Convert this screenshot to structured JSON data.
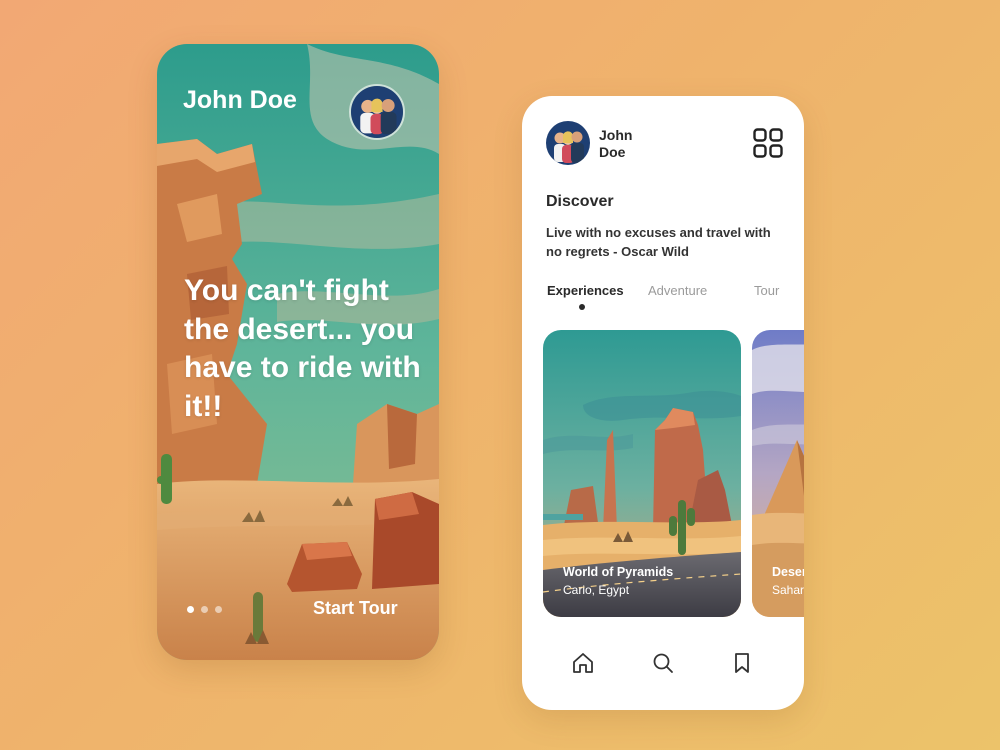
{
  "onboarding": {
    "user_name": "John Doe",
    "headline": "You can't fight the desert... you have to ride with it!!",
    "pager": {
      "count": 3,
      "active": 0
    },
    "start_label": "Start Tour"
  },
  "discover": {
    "user_name": "John Doe",
    "title": "Discover",
    "quote": "Live with no excuses and travel with no regrets - Oscar Wild",
    "tabs": [
      {
        "label": "Experiences",
        "active": true
      },
      {
        "label": "Adventure",
        "active": false
      },
      {
        "label": "Tour",
        "active": false
      }
    ],
    "cards": [
      {
        "title": "World of Pyramids",
        "subtitle": "Cario, Egypt"
      },
      {
        "title": "Deser",
        "subtitle": "Sahar"
      }
    ],
    "bottom_nav": [
      "home-icon",
      "search-icon",
      "bookmark-icon"
    ]
  },
  "icons": {
    "grid": "grid-icon",
    "avatar": "avatar"
  },
  "colors": {
    "background_start": "#f2a874",
    "background_end": "#ecc36a",
    "text_dark": "#2a2a2a",
    "tab_inactive": "#9b9b9b"
  }
}
